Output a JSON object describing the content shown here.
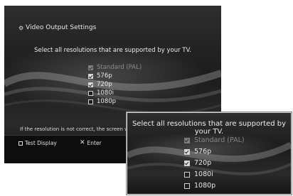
{
  "main": {
    "title": "Video Output Settings",
    "prompt": "Select all resolutions that are supported by your TV.",
    "options": [
      {
        "label": "Standard (PAL)",
        "checked": true,
        "disabled": true
      },
      {
        "label": "576p",
        "checked": true,
        "disabled": false
      },
      {
        "label": "720p",
        "checked": true,
        "disabled": false
      },
      {
        "label": "1080i",
        "checked": false,
        "disabled": false
      },
      {
        "label": "1080p",
        "checked": false,
        "disabled": false
      }
    ],
    "note": "If the resolution is not correct, the screen wil",
    "footer": {
      "test_display": "Test Display",
      "enter": "Enter"
    }
  },
  "zoom": {
    "prompt": "Select all resolutions that are supported by your TV.",
    "options": [
      {
        "label": "Standard (PAL)",
        "checked": true,
        "disabled": true
      },
      {
        "label": "576p",
        "checked": true,
        "disabled": false
      },
      {
        "label": "720p",
        "checked": true,
        "disabled": false
      },
      {
        "label": "1080i",
        "checked": false,
        "disabled": false
      },
      {
        "label": "1080p",
        "checked": false,
        "disabled": false
      }
    ]
  },
  "icons": {
    "settings": "settings-icon",
    "square_button": "square-button-icon",
    "cross_button": "cross-button-icon"
  }
}
